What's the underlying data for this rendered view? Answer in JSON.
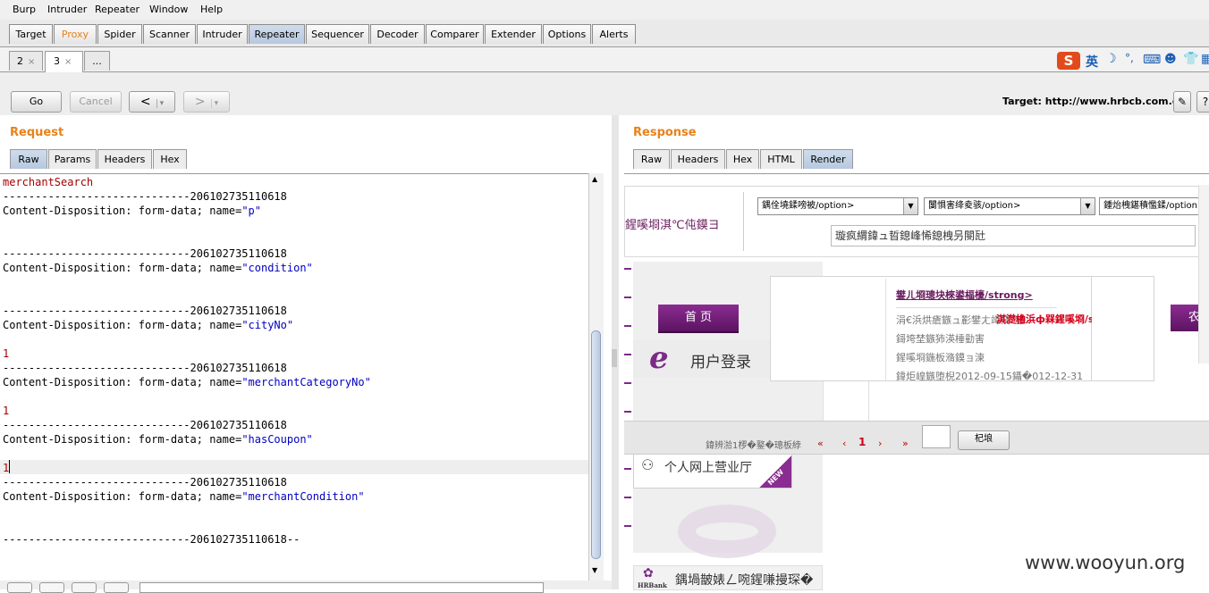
{
  "menu": [
    "Burp",
    "Intruder",
    "Repeater",
    "Window",
    "Help"
  ],
  "main_tabs": [
    "Target",
    "Proxy",
    "Spider",
    "Scanner",
    "Intruder",
    "Repeater",
    "Sequencer",
    "Decoder",
    "Comparer",
    "Extender",
    "Options",
    "Alerts"
  ],
  "sub_tabs": [
    {
      "label": "2",
      "close": "×"
    },
    {
      "label": "3",
      "close": "×"
    },
    {
      "label": "..."
    }
  ],
  "ime": {
    "lang": "英"
  },
  "toolbar": {
    "go": "Go",
    "cancel": "Cancel",
    "back": "<",
    "fwd": ">",
    "dropdown": "▾",
    "target_label": "Target:",
    "target_value": "http://www.hrbcb.com.cn"
  },
  "request": {
    "title": "Request",
    "tabs": [
      "Raw",
      "Params",
      "Headers",
      "Hex"
    ],
    "lines": [
      {
        "t": "merchantSearch",
        "c": "red"
      },
      {
        "t": "-----------------------------206102735110618",
        "c": ""
      },
      {
        "t": "Content-Disposition: form-data; name=\"p\"",
        "c": "mix",
        "k": "Content-Disposition: form-data; name=",
        "v": "\"p\""
      },
      {
        "t": "",
        "c": ""
      },
      {
        "t": "",
        "c": ""
      },
      {
        "t": "-----------------------------206102735110618",
        "c": ""
      },
      {
        "t": "",
        "c": "mix",
        "k": "Content-Disposition: form-data; name=",
        "v": "\"condition\""
      },
      {
        "t": "",
        "c": ""
      },
      {
        "t": "",
        "c": ""
      },
      {
        "t": "-----------------------------206102735110618",
        "c": ""
      },
      {
        "t": "",
        "c": "mix",
        "k": "Content-Disposition: form-data; name=",
        "v": "\"cityNo\""
      },
      {
        "t": "",
        "c": ""
      },
      {
        "t": "1",
        "c": "red"
      },
      {
        "t": "-----------------------------206102735110618",
        "c": ""
      },
      {
        "t": "",
        "c": "mix",
        "k": "Content-Disposition: form-data; name=",
        "v": "\"merchantCategoryNo\""
      },
      {
        "t": "",
        "c": ""
      },
      {
        "t": "1",
        "c": "red"
      },
      {
        "t": "-----------------------------206102735110618",
        "c": ""
      },
      {
        "t": "",
        "c": "mix",
        "k": "Content-Disposition: form-data; name=",
        "v": "\"hasCoupon\""
      },
      {
        "t": "",
        "c": ""
      },
      {
        "t": "1",
        "c": "red"
      },
      {
        "t": "-----------------------------206102735110618",
        "c": ""
      },
      {
        "t": "",
        "c": "mix",
        "k": "Content-Disposition: form-data; name=",
        "v": "\"merchantCondition\""
      },
      {
        "t": "",
        "c": ""
      },
      {
        "t": "",
        "c": ""
      },
      {
        "t": "-----------------------------206102735110618--",
        "c": ""
      }
    ]
  },
  "response": {
    "title": "Response",
    "tabs": [
      "Raw",
      "Headers",
      "Hex",
      "HTML",
      "Render"
    ],
    "render": {
      "search_label": "鍟嗘埛淇℃伅鏌ヨ",
      "select1": "鍝佺墝鍒嗙被/option>",
      "select2": "闅惧害绛夌骇/option>",
      "select3": "鍾炲栧鍖積懢鍒/option",
      "input_value": "璇疯緭鍏ュ晢鎴峰悕鎴栧叧閿瓧",
      "home_btn": "首  页",
      "login": "用户登录",
      "personal": "个人网上营业厅",
      "new_badge": "NEW",
      "popup_title": "鐢ㄦ埛璁块棶鍙楅檺/strong>",
      "popup_red": "淇濋櫓浜ф槑鍟嗘埛/strong>",
      "popup_lines": [
        "涓€浜烘瘡鏃ュ彲鐢ㄤ竴娆″埜...",
        "鎶垮埜鏃犻渶棰勭害",
        "鍟嗘埛鍦板潃鏌ョ湅",
        "鍏炬崲鏃堕棿2012-09-15鑷�012-12-31"
      ],
      "side_right": "农村",
      "pager_text": "鍏辨湁1椤�鐜�璁板綍",
      "pager_prev2": "«",
      "pager_prev": "‹",
      "pager_page": "1",
      "pager_next": "›",
      "pager_next2": "»",
      "go_btn": "杞埌",
      "bottom_bank": "鍝堝皵婊ㄥ啘鍟嗛摱琛�",
      "hrbank": "HRBank",
      "watermark": "www.wooyun.org"
    }
  }
}
